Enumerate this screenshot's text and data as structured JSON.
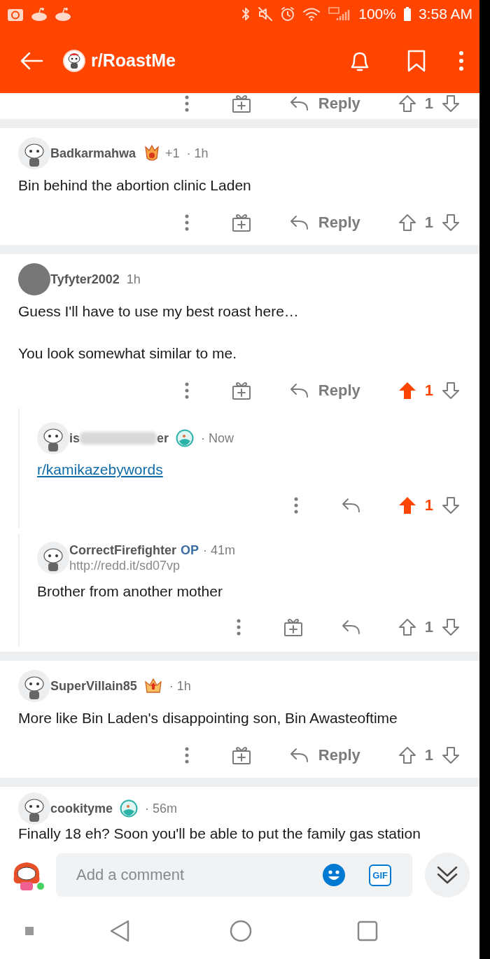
{
  "status_bar": {
    "battery": "100%",
    "time": "3:58 AM"
  },
  "app_bar": {
    "title": "r/RoastMe"
  },
  "clipped_actions": {
    "gift": true,
    "reply_label": "Reply",
    "score": "1",
    "upvoted": false
  },
  "comments": [
    {
      "username": "Badkarmahwa",
      "avatar": {
        "kind": "snoo"
      },
      "badge": {
        "kind": "award"
      },
      "award_count": "+1",
      "time": "· 1h",
      "body": [
        "Bin behind the abortion clinic Laden"
      ],
      "actions": {
        "gift": true,
        "reply_label": "Reply",
        "score": "1",
        "upvoted": false
      }
    },
    {
      "username": "Tyfyter2002",
      "avatar": {
        "kind": "photo"
      },
      "time": "1h",
      "body": [
        "Guess I'll have to use my best roast here…",
        "You look somewhat similar to me."
      ],
      "actions": {
        "gift": true,
        "reply_label": "Reply",
        "score": "1",
        "upvoted": true
      },
      "replies": [
        {
          "username_parts": [
            "is",
            "er"
          ],
          "avatar": {
            "kind": "snoo"
          },
          "badge": {
            "kind": "orb"
          },
          "time": "· Now",
          "link": "r/kamikazebywords",
          "actions": {
            "gift": false,
            "score": "1",
            "upvoted": true
          }
        },
        {
          "username": "CorrectFirefighter",
          "op": "OP",
          "avatar": {
            "kind": "snoo"
          },
          "time": "· 41m",
          "flair": "http://redd.it/sd07vp",
          "body": [
            "Brother from another mother"
          ],
          "actions": {
            "gift": true,
            "score": "1",
            "upvoted": false
          }
        }
      ]
    },
    {
      "username": "SuperVillain85",
      "avatar": {
        "kind": "snoo"
      },
      "badge": {
        "kind": "crown"
      },
      "time": "· 1h",
      "body": [
        "More like Bin Laden's disappointing son, Bin Awasteoftime"
      ],
      "actions": {
        "gift": true,
        "reply_label": "Reply",
        "score": "1",
        "upvoted": false
      }
    },
    {
      "username": "cookityme",
      "avatar": {
        "kind": "snoo"
      },
      "badge": {
        "kind": "orb"
      },
      "time": "· 56m",
      "body": [
        "Finally 18 eh? Soon you'll be able to put the family gas station"
      ]
    }
  ],
  "composer": {
    "placeholder": "Add a comment",
    "gif_label": "GIF",
    "online": true
  }
}
